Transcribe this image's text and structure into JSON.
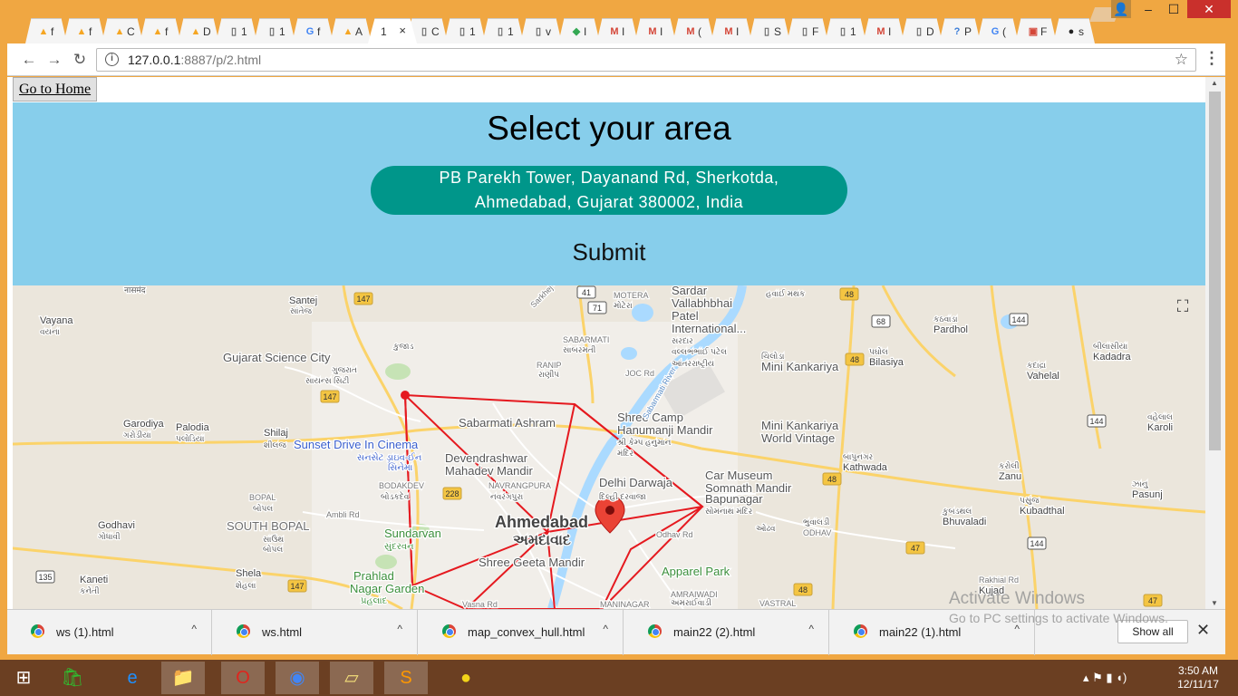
{
  "browser": {
    "tabs": [
      {
        "icon": "firebase-icon",
        "glyph": "▲",
        "color": "#f5a623",
        "label": "f"
      },
      {
        "icon": "firebase-icon",
        "glyph": "▲",
        "color": "#f5a623",
        "label": "f"
      },
      {
        "icon": "firebase-icon",
        "glyph": "▲",
        "color": "#f5a623",
        "label": "C"
      },
      {
        "icon": "firebase-icon",
        "glyph": "▲",
        "color": "#f5a623",
        "label": "f"
      },
      {
        "icon": "firebase-icon",
        "glyph": "▲",
        "color": "#f5a623",
        "label": "D"
      },
      {
        "icon": "page-icon",
        "glyph": "▯",
        "color": "#666666",
        "label": "1"
      },
      {
        "icon": "page-icon",
        "glyph": "▯",
        "color": "#666666",
        "label": "1"
      },
      {
        "icon": "google-icon",
        "glyph": "G",
        "color": "#4285f4",
        "label": "f"
      },
      {
        "icon": "firebase-icon",
        "glyph": "▲",
        "color": "#f5a623",
        "label": "A"
      },
      {
        "icon": "none",
        "glyph": "",
        "color": "#333333",
        "label": "1",
        "active": true
      },
      {
        "icon": "page-icon",
        "glyph": "▯",
        "color": "#666666",
        "label": "C"
      },
      {
        "icon": "page-icon",
        "glyph": "▯",
        "color": "#666666",
        "label": "1"
      },
      {
        "icon": "page-icon",
        "glyph": "▯",
        "color": "#666666",
        "label": "1"
      },
      {
        "icon": "page-icon",
        "glyph": "▯",
        "color": "#666666",
        "label": "v"
      },
      {
        "icon": "maps-icon",
        "glyph": "◆",
        "color": "#34a853",
        "label": "I"
      },
      {
        "icon": "gmail-icon",
        "glyph": "M",
        "color": "#d44638",
        "label": "I"
      },
      {
        "icon": "gmail-icon",
        "glyph": "M",
        "color": "#d44638",
        "label": "I"
      },
      {
        "icon": "gmail-icon",
        "glyph": "M",
        "color": "#d44638",
        "label": "("
      },
      {
        "icon": "gmail-icon",
        "glyph": "M",
        "color": "#d44638",
        "label": "I"
      },
      {
        "icon": "page-icon",
        "glyph": "▯",
        "color": "#666666",
        "label": "S"
      },
      {
        "icon": "page-icon",
        "glyph": "▯",
        "color": "#666666",
        "label": "F"
      },
      {
        "icon": "page-icon",
        "glyph": "▯",
        "color": "#666666",
        "label": "1"
      },
      {
        "icon": "gmail-icon",
        "glyph": "M",
        "color": "#d44638",
        "label": "I"
      },
      {
        "icon": "page-icon",
        "glyph": "▯",
        "color": "#666666",
        "label": "D"
      },
      {
        "icon": "help-icon",
        "glyph": "?",
        "color": "#3b7dd8",
        "label": "P"
      },
      {
        "icon": "google-icon",
        "glyph": "G",
        "color": "#4285f4",
        "label": "("
      },
      {
        "icon": "app-icon",
        "glyph": "▣",
        "color": "#d44638",
        "label": "F"
      },
      {
        "icon": "github-icon",
        "glyph": "●",
        "color": "#222222",
        "label": "s"
      }
    ],
    "active_tab_close": "×",
    "window_controls": {
      "user": "👤",
      "minimize": "–",
      "maximize": "☐",
      "close": "✕"
    },
    "nav": {
      "back": "←",
      "forward": "→",
      "reload": "↻"
    },
    "url_info": "i",
    "url_host": "127.0.0.1",
    "url_rest": ":8887/p/2.html",
    "star": "☆",
    "menu": "⋮"
  },
  "page": {
    "home_button": "Go to Home",
    "title": "Select your area",
    "address_line1": "PB Parekh Tower, Dayanand Rd, Sherkotda,",
    "address_line2": "Ahmedabad, Gujarat 380002, India",
    "submit": "Submit",
    "fullscreen": "⛶"
  },
  "map": {
    "road_shields": [
      "147",
      "147",
      "147",
      "41",
      "71",
      "48",
      "48",
      "48",
      "48",
      "47",
      "47",
      "68",
      "144",
      "144",
      "144",
      "228",
      "135"
    ],
    "places": [
      {
        "name": "नासमंद",
        "cls": "small"
      },
      {
        "name": "Santej",
        "cls": "norm"
      },
      {
        "name": "સાંતેજ",
        "cls": "small"
      },
      {
        "name": "Vayana",
        "cls": "norm"
      },
      {
        "name": "વયના",
        "cls": "small"
      },
      {
        "name": "Gujarat Science City",
        "cls": "poi"
      },
      {
        "name": "ગુજરાત",
        "cls": "small"
      },
      {
        "name": "સાયન્સ સિટી",
        "cls": "small"
      },
      {
        "name": "Garodiya",
        "cls": "norm"
      },
      {
        "name": "ગરોડીયા",
        "cls": "small"
      },
      {
        "name": "Palodia",
        "cls": "norm"
      },
      {
        "name": "પલોડિયા",
        "cls": "small"
      },
      {
        "name": "Shilaj",
        "cls": "norm"
      },
      {
        "name": "શીલજ",
        "cls": "small"
      },
      {
        "name": "Sunset Drive In Cinema",
        "cls": "blue"
      },
      {
        "name": "સનસેટ ડ્રાઇવ-ઈન",
        "cls": "bluesmall"
      },
      {
        "name": "સિનેમા",
        "cls": "bluesmall"
      },
      {
        "name": "BOPAL",
        "cls": "caps"
      },
      {
        "name": "બોપલ",
        "cls": "small"
      },
      {
        "name": "Godhavi",
        "cls": "norm"
      },
      {
        "name": "ગોધાવી",
        "cls": "small"
      },
      {
        "name": "SOUTH BOPAL",
        "cls": "capsbig"
      },
      {
        "name": "સાઉથ",
        "cls": "small"
      },
      {
        "name": "બોપલ",
        "cls": "small"
      },
      {
        "name": "Kaneti",
        "cls": "norm"
      },
      {
        "name": "કનેતી",
        "cls": "small"
      },
      {
        "name": "Shela",
        "cls": "norm"
      },
      {
        "name": "શેહલા",
        "cls": "small"
      },
      {
        "name": "BODAKDEV",
        "cls": "caps"
      },
      {
        "name": "બોડકદેવ",
        "cls": "small"
      },
      {
        "name": "Ambli Rd",
        "cls": "road"
      },
      {
        "name": "Sundarvan",
        "cls": "green"
      },
      {
        "name": "સુંદરવન",
        "cls": "greensmall"
      },
      {
        "name": "Prahlad",
        "cls": "green"
      },
      {
        "name": "Nagar Garden",
        "cls": "green"
      },
      {
        "name": "પ્રહલાદ",
        "cls": "greensmall"
      },
      {
        "name": "Devendrashwar",
        "cls": "poi"
      },
      {
        "name": "Mahadev Mandir",
        "cls": "poi"
      },
      {
        "name": "Sabarmati Ashram",
        "cls": "poi"
      },
      {
        "name": "NAVRANGPURA",
        "cls": "caps"
      },
      {
        "name": "નવરંગપુરા",
        "cls": "small"
      },
      {
        "name": "Ahmedabad",
        "cls": "city"
      },
      {
        "name": "અમદાવાદ",
        "cls": "citysmall"
      },
      {
        "name": "Delhi Darwaja",
        "cls": "poi"
      },
      {
        "name": "દિલ્હી દરવાજા",
        "cls": "small"
      },
      {
        "name": "Shree Geeta Mandir",
        "cls": "poi"
      },
      {
        "name": "Apparel Park",
        "cls": "green"
      },
      {
        "name": "Vasna Rd",
        "cls": "road"
      },
      {
        "name": "MANINAGAR",
        "cls": "caps"
      },
      {
        "name": "AMRAIWADI",
        "cls": "caps"
      },
      {
        "name": "અમરાઈવાડી",
        "cls": "small"
      },
      {
        "name": "VASTRAL",
        "cls": "caps"
      },
      {
        "name": "MOTERA",
        "cls": "caps"
      },
      {
        "name": "મોટેરા",
        "cls": "small"
      },
      {
        "name": "SABARMATI",
        "cls": "caps"
      },
      {
        "name": "સાબરમતી",
        "cls": "small"
      },
      {
        "name": "RANIP",
        "cls": "caps"
      },
      {
        "name": "રાણીપ",
        "cls": "small"
      },
      {
        "name": "Shree Camp",
        "cls": "poi"
      },
      {
        "name": "Hanumanji Mandir",
        "cls": "poi"
      },
      {
        "name": "શ્રી કેમ્પ હનુમાન",
        "cls": "small"
      },
      {
        "name": "મંદિર",
        "cls": "small"
      },
      {
        "name": "Sardar",
        "cls": "poi"
      },
      {
        "name": "Vallabhbhai",
        "cls": "poi"
      },
      {
        "name": "Patel",
        "cls": "poi"
      },
      {
        "name": "International...",
        "cls": "poi"
      },
      {
        "name": "સરદાર",
        "cls": "small"
      },
      {
        "name": "વલ્લભભાઈ પટેલ",
        "cls": "small"
      },
      {
        "name": "આંતરરાષ્ટ્રીય",
        "cls": "small"
      },
      {
        "name": "હવાઈ મથક",
        "cls": "small"
      },
      {
        "name": "ચિલોડા",
        "cls": "small"
      },
      {
        "name": "Mini Kankariya",
        "cls": "poi"
      },
      {
        "name": "Mini Kankariya",
        "cls": "poi"
      },
      {
        "name": "World Vintage",
        "cls": "poi"
      },
      {
        "name": "Car Museum",
        "cls": "poi"
      },
      {
        "name": "Somnath Mandir",
        "cls": "poi"
      },
      {
        "name": "Bapunagar",
        "cls": "poi"
      },
      {
        "name": "સોમનાથ મંદિર",
        "cls": "small"
      },
      {
        "name": "બાપુનગર",
        "cls": "small"
      },
      {
        "name": "Kathwada",
        "cls": "norm"
      },
      {
        "name": "કઠવાડા",
        "cls": "small"
      },
      {
        "name": "Pardhol",
        "cls": "norm"
      },
      {
        "name": "પઘોલ",
        "cls": "small"
      },
      {
        "name": "Bilasiya",
        "cls": "norm"
      },
      {
        "name": "બીલાસીયા",
        "cls": "small"
      },
      {
        "name": "Kadadra",
        "cls": "norm"
      },
      {
        "name": "કદાદ્રા",
        "cls": "small"
      },
      {
        "name": "Vahelal",
        "cls": "norm"
      },
      {
        "name": "વહેલાલ",
        "cls": "small"
      },
      {
        "name": "Karoli",
        "cls": "norm"
      },
      {
        "name": "કરોલી",
        "cls": "small"
      },
      {
        "name": "Zanu",
        "cls": "norm"
      },
      {
        "name": "ઝાનુ",
        "cls": "small"
      },
      {
        "name": "Pasunj",
        "cls": "norm"
      },
      {
        "name": "પસુંજ",
        "cls": "small"
      },
      {
        "name": "Kubadthal",
        "cls": "norm"
      },
      {
        "name": "કુબડથલ",
        "cls": "small"
      },
      {
        "name": "Bhuvaladi",
        "cls": "norm"
      },
      {
        "name": "ભુવાલડી",
        "cls": "small"
      },
      {
        "name": "ODHAV",
        "cls": "caps"
      },
      {
        "name": "ઓઢવ",
        "cls": "small"
      },
      {
        "name": "Odhav Rd",
        "cls": "road"
      },
      {
        "name": "Rakhial Rd",
        "cls": "road"
      },
      {
        "name": "Kujad",
        "cls": "norm"
      },
      {
        "name": "કુજાડ",
        "cls": "small"
      },
      {
        "name": "Sarkhej - Gandhinagar Hwy",
        "cls": "road"
      },
      {
        "name": "JOC Rd",
        "cls": "road"
      },
      {
        "name": "Sabarmati River",
        "cls": "water"
      },
      {
        "name": "Sabarmati River",
        "cls": "water"
      }
    ]
  },
  "downloads": {
    "items": [
      "ws (1).html",
      "ws.html",
      "map_convex_hull.html",
      "main22 (2).html",
      "main22 (1).html"
    ],
    "caret": "^",
    "show_all": "Show all",
    "close": "✕"
  },
  "watermark": {
    "line1": "Activate Windows",
    "line2": "Go to PC settings to activate Windows."
  },
  "taskbar": {
    "apps": [
      {
        "name": "windows-start-icon",
        "glyph": "⊞",
        "color": "#ffffff"
      },
      {
        "name": "store-icon",
        "glyph": "🛍",
        "color": "#2fbf2f"
      },
      {
        "name": "ie-icon",
        "glyph": "e",
        "color": "#1e90ff"
      },
      {
        "name": "file-explorer-icon",
        "glyph": "📁",
        "color": "#f6c343"
      },
      {
        "name": "opera-icon",
        "glyph": "O",
        "color": "#e0241d"
      },
      {
        "name": "chrome-icon",
        "glyph": "◉",
        "color": "#4285f4"
      },
      {
        "name": "sticky-notes-icon",
        "glyph": "▱",
        "color": "#f5e17a"
      },
      {
        "name": "sublime-icon",
        "glyph": "S",
        "color": "#ff9800"
      },
      {
        "name": "app-ok-icon",
        "glyph": "●",
        "color": "#f2d419"
      }
    ],
    "time": "3:50 AM",
    "date": "12/11/17"
  }
}
